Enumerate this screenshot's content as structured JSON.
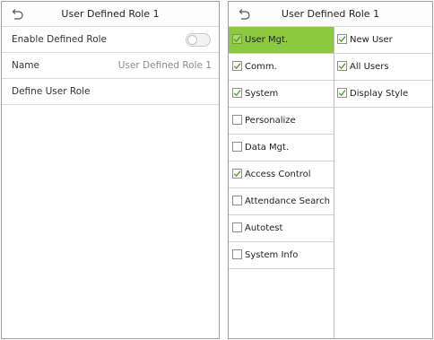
{
  "left_screen": {
    "title": "User Defined Role 1",
    "enable_label": "Enable Defined Role",
    "name_label": "Name",
    "name_value": "User Defined Role 1",
    "define_label": "Define User Role",
    "enable_checked": false
  },
  "right_screen": {
    "title": "User Defined Role 1",
    "accent_color": "#8cc93f",
    "categories": [
      {
        "label": "User Mgt.",
        "checked": true,
        "selected": true
      },
      {
        "label": "Comm.",
        "checked": true,
        "selected": false
      },
      {
        "label": "System",
        "checked": true,
        "selected": false
      },
      {
        "label": "Personalize",
        "checked": false,
        "selected": false
      },
      {
        "label": "Data Mgt.",
        "checked": false,
        "selected": false
      },
      {
        "label": "Access Control",
        "checked": true,
        "selected": false
      },
      {
        "label": "Attendance Search",
        "checked": false,
        "selected": false
      },
      {
        "label": "Autotest",
        "checked": false,
        "selected": false
      },
      {
        "label": "System Info",
        "checked": false,
        "selected": false
      }
    ],
    "sub_items": [
      {
        "label": "New User",
        "checked": true
      },
      {
        "label": "All Users",
        "checked": true
      },
      {
        "label": "Display Style",
        "checked": true
      }
    ]
  },
  "icons": {
    "back": "back-arrow-icon",
    "check": "checkmark-icon"
  }
}
